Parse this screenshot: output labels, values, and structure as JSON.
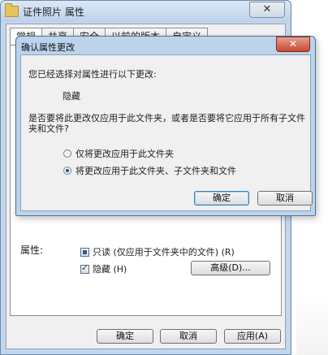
{
  "back_window": {
    "title": "证件照片 属性",
    "close_label": "✕",
    "tabs": [
      "常规",
      "共享",
      "安全",
      "以前的版本",
      "自定义"
    ],
    "attributes_label": "属性:",
    "readonly_label": "只读 (仅应用于文件夹中的文件) (R)",
    "hidden_label": "隐藏 (H)",
    "advanced_button": "高级(D)...",
    "ok_button": "确定",
    "cancel_button": "取消",
    "apply_button": "应用(A)"
  },
  "dialog": {
    "title": "确认属性更改",
    "close_label": "✕",
    "message": "您已经选择对属性进行以下更改:",
    "attribute_change": "隐藏",
    "question": "是否要将此更改仅应用于此文件夹，或者是否要将它应用于所有子文件夹和文件?",
    "option_folder_only": "仅将更改应用于此文件夹",
    "option_all": "将更改应用于此文件夹、子文件夹和文件",
    "selected_option": "option_all",
    "ok_button": "确定",
    "cancel_button": "取消"
  }
}
